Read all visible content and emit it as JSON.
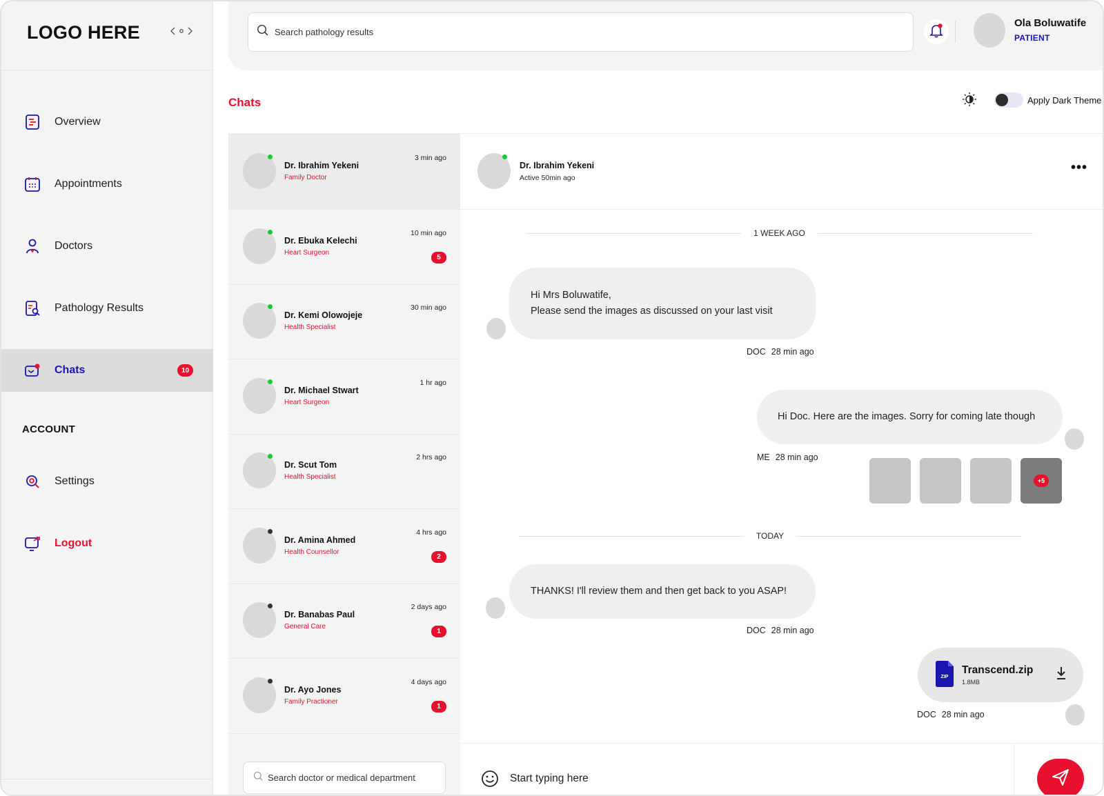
{
  "brand": {
    "logo": "LOGO HERE",
    "collapse_icon": "arrows-left-right-icon"
  },
  "sidebar": {
    "items": [
      {
        "label": "Overview",
        "icon": "overview-icon"
      },
      {
        "label": "Appointments",
        "icon": "calendar-icon"
      },
      {
        "label": "Doctors",
        "icon": "doctor-icon"
      },
      {
        "label": "Pathology Results",
        "icon": "report-icon"
      },
      {
        "label": "Chats",
        "icon": "chat-icon",
        "badge": "10",
        "active": true
      }
    ],
    "account_heading": "ACCOUNT",
    "account_items": [
      {
        "label": "Settings",
        "icon": "settings-icon"
      },
      {
        "label": "Logout",
        "icon": "logout-icon"
      }
    ]
  },
  "topbar": {
    "search_placeholder": "Search pathology results",
    "user": {
      "name": "Ola Boluwatife",
      "role": "PATIENT"
    }
  },
  "page": {
    "title": "Chats",
    "theme_toggle_label": "Apply Dark Theme",
    "dark_theme_on": false
  },
  "conversations": [
    {
      "name": "Dr. Ibrahim Yekeni",
      "role": "Family Doctor",
      "time": "3 min ago",
      "online": true,
      "badge": ""
    },
    {
      "name": "Dr. Ebuka Kelechi",
      "role": "Heart Surgeon",
      "time": "10 min ago",
      "online": true,
      "badge": "5"
    },
    {
      "name": "Dr. Kemi Olowojeje",
      "role": "Health Specialist",
      "time": "30 min ago",
      "online": true,
      "badge": ""
    },
    {
      "name": "Dr. Michael Stwart",
      "role": "Heart Surgeon",
      "time": "1 hr ago",
      "online": true,
      "badge": ""
    },
    {
      "name": "Dr. Scut Tom",
      "role": "Health Specialist",
      "time": "2 hrs ago",
      "online": true,
      "badge": ""
    },
    {
      "name": "Dr. Amina Ahmed",
      "role": "Health Counsellor",
      "time": "4 hrs ago",
      "online": false,
      "badge": "2"
    },
    {
      "name": "Dr. Banabas Paul",
      "role": "General Care",
      "time": "2 days ago",
      "online": false,
      "badge": "1"
    },
    {
      "name": "Dr. Ayo Jones",
      "role": "Family Practioner",
      "time": "4 days ago",
      "online": false,
      "badge": "1"
    }
  ],
  "list_search_placeholder": "Search doctor or medical department",
  "thread": {
    "header": {
      "name": "Dr. Ibrahim Yekeni",
      "status": "Active 50min ago",
      "more_icon": "more-horizontal-icon"
    },
    "dividers": [
      "1 WEEK AGO",
      "TODAY"
    ],
    "messages": [
      {
        "line1": "Hi Mrs Boluwatife,",
        "line2": "Please send the images as discussed on your last visit",
        "who": "DOC",
        "time": "28 min ago"
      },
      {
        "text": "Hi Doc. Here are the images. Sorry for coming late though",
        "who": "ME",
        "time": "28 min ago",
        "extra_images": "+5"
      },
      {
        "text": "THANKS! I'll review them and then get back to you ASAP!",
        "who": "DOC",
        "time": "28 min ago"
      }
    ],
    "file": {
      "name": "Transcend.zip",
      "size": "1.8MB",
      "ext": "ZIP",
      "who": "DOC",
      "time": "28 min ago"
    }
  },
  "composer": {
    "placeholder": "Start typing here"
  },
  "colors": {
    "accent_red": "#e8112d",
    "accent_blue": "#1a14b0",
    "online_green": "#18c93a",
    "offline_dark": "#333333"
  }
}
